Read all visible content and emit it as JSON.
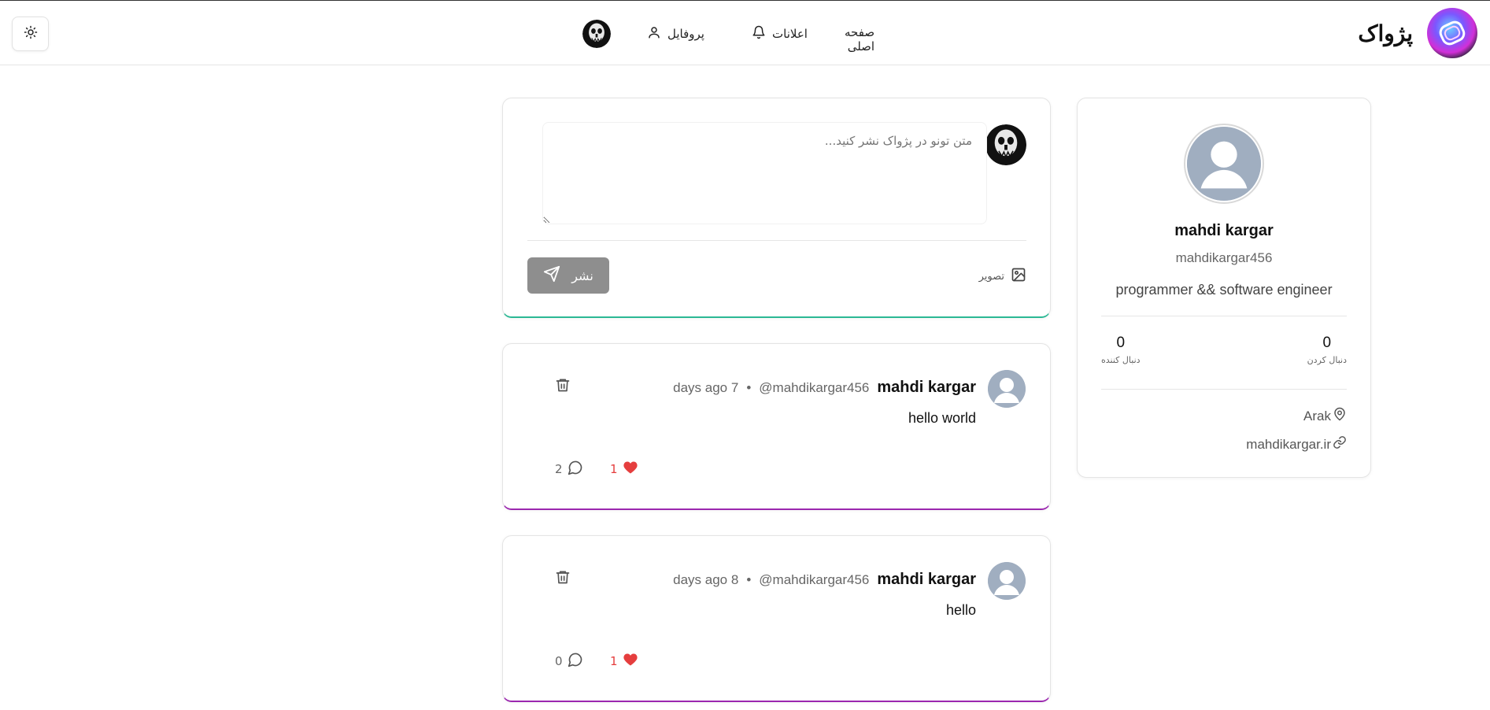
{
  "header": {
    "brand_title": "پژواک",
    "nav": {
      "home_label": "صفحه اصلی",
      "notifications_label": "اعلانات",
      "profile_label": "پروفایل"
    }
  },
  "composer": {
    "placeholder": "متن تونو در پژواک نشر کنید...",
    "image_label": "تصویر",
    "publish_label": "نشر"
  },
  "posts": [
    {
      "name": "mahdi kargar",
      "username": "@mahdikargar456",
      "separator": "•",
      "time": "days ago 7",
      "text": "hello world",
      "likes": "1",
      "comments": "2"
    },
    {
      "name": "mahdi kargar",
      "username": "@mahdikargar456",
      "separator": "•",
      "time": "days ago 8",
      "text": "hello",
      "likes": "1",
      "comments": "0"
    }
  ],
  "profile": {
    "name": "mahdi kargar",
    "username": "mahdikargar456",
    "bio": "programmer && software engineer",
    "following_count": "0",
    "following_label": "دنبال کردن",
    "followers_count": "0",
    "followers_label": "دنبال کننده",
    "location": "Arak",
    "website": "mahdikargar.ir"
  },
  "colors": {
    "composer_accent": "#2bb894",
    "post_accent": "#9b27af",
    "like_color": "#e53e3e",
    "publish_button": "#8e8e8e"
  },
  "icons": {
    "theme": "sun-icon",
    "notifications": "bell-icon",
    "profile": "user-icon",
    "image": "image-icon",
    "publish": "send-icon",
    "delete": "trash-icon",
    "comment": "comment-icon",
    "like": "heart-icon",
    "location": "map-pin-icon",
    "website": "link-icon"
  }
}
